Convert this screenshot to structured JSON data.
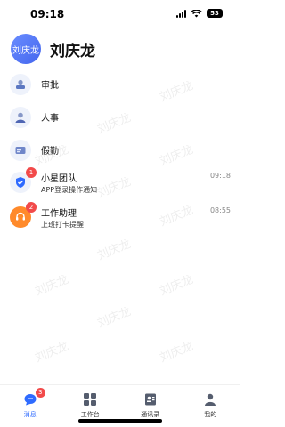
{
  "status": {
    "time": "09:18",
    "battery": "53"
  },
  "header": {
    "avatar_text": "刘庆龙",
    "title": "刘庆龙"
  },
  "watermark": "刘庆龙",
  "list": [
    {
      "label": "审批",
      "icon": "approval-icon"
    },
    {
      "label": "人事",
      "icon": "personnel-icon"
    },
    {
      "label": "假勤",
      "icon": "attendance-icon"
    },
    {
      "label": "小星团队",
      "sub": "APP登录操作通知",
      "time": "09:18",
      "badge": "1",
      "icon": "team-shield-icon"
    },
    {
      "label": "工作助理",
      "sub": "上班打卡提醒",
      "time": "08:55",
      "badge": "2",
      "icon": "assistant-headset-icon"
    }
  ],
  "tabs": [
    {
      "label": "消息",
      "badge": "3",
      "icon": "chat-icon"
    },
    {
      "label": "工作台",
      "icon": "workbench-grid-icon"
    },
    {
      "label": "通讯录",
      "icon": "contacts-icon"
    },
    {
      "label": "我的",
      "icon": "profile-icon"
    }
  ],
  "colors": {
    "accent": "#2f6bff",
    "badge": "#f24a4a",
    "assistant": "#ff8a2b"
  }
}
